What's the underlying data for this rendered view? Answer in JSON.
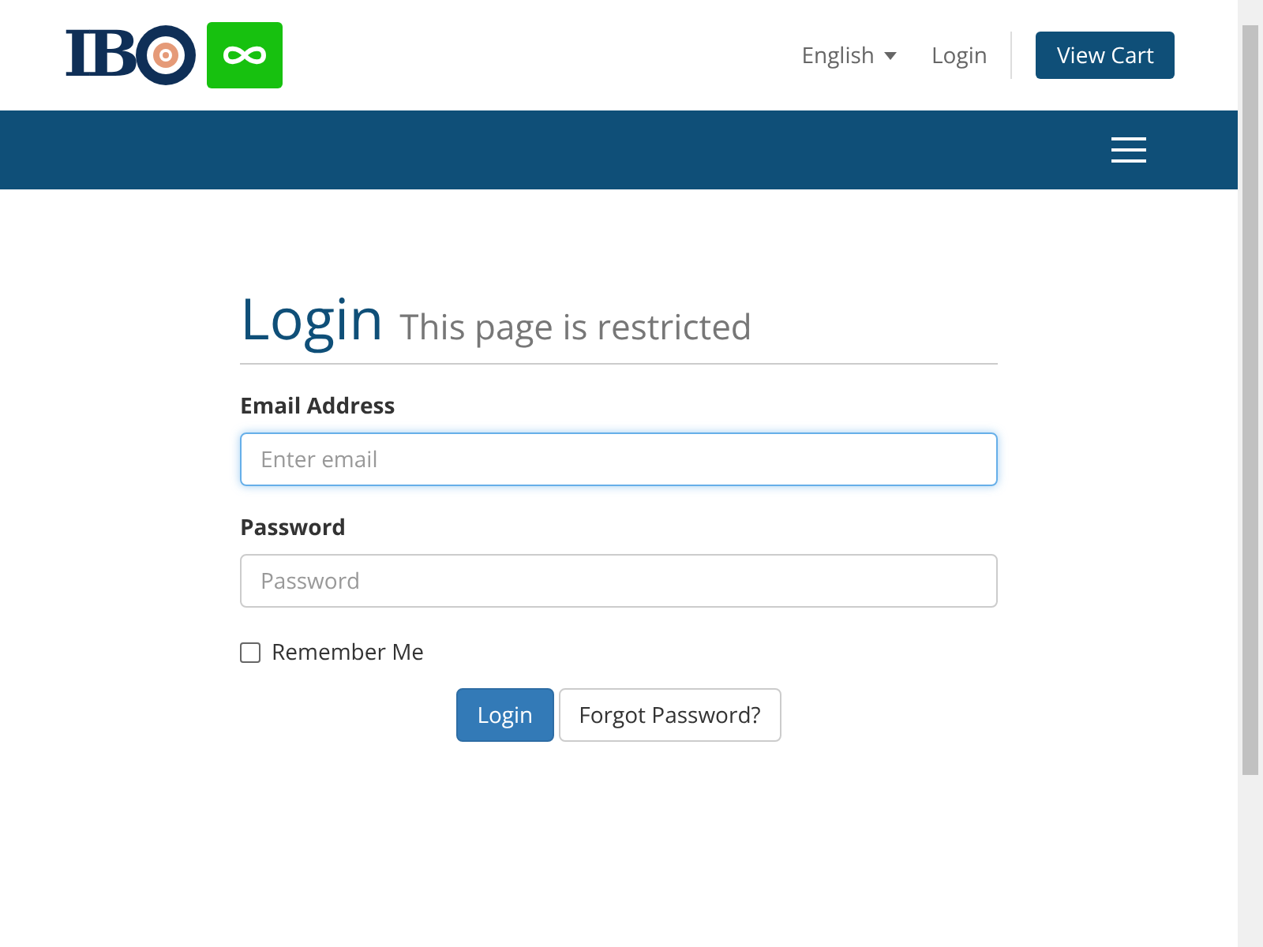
{
  "header": {
    "logo": {
      "text": "IB"
    },
    "language": "English",
    "login_link": "Login",
    "cart_button": "View Cart"
  },
  "form": {
    "title": "Login",
    "subtitle": "This page is restricted",
    "fields": [
      {
        "label": "Email Address",
        "placeholder": "Enter email",
        "focused": true
      },
      {
        "label": "Password",
        "placeholder": "Password",
        "focused": false
      }
    ],
    "remember": {
      "label": "Remember Me",
      "checked": false
    },
    "buttons": [
      {
        "label": "Login",
        "kind": "primary"
      },
      {
        "label": "Forgot Password?",
        "kind": "default"
      }
    ]
  }
}
